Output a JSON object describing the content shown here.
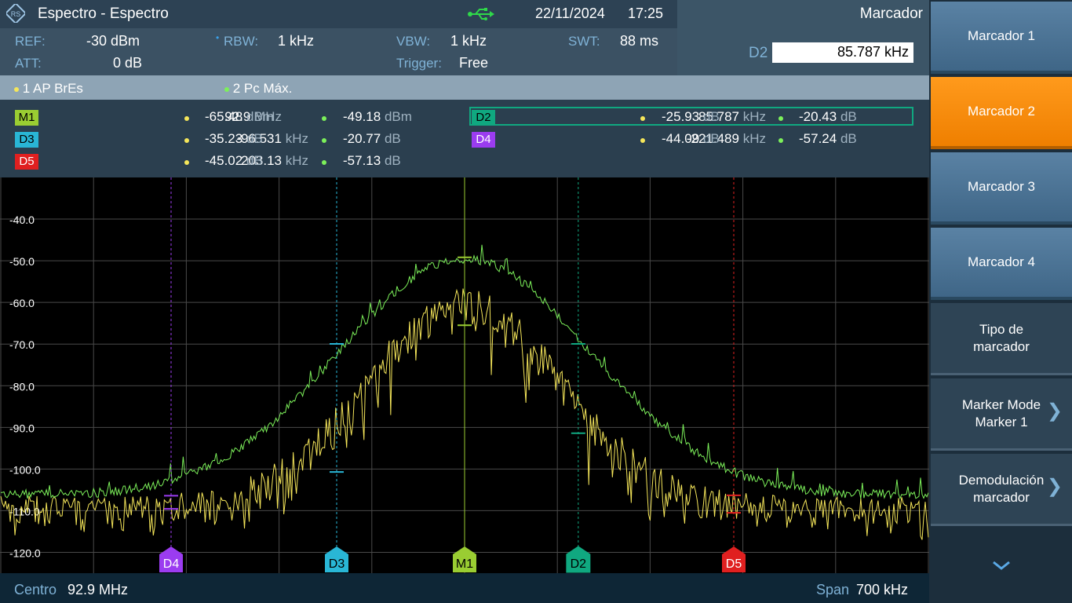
{
  "header": {
    "title": "Espectro - Espectro",
    "date": "22/11/2024",
    "time": "17:25",
    "menu_title": "Marcador"
  },
  "settings": {
    "ref_label": "REF:",
    "ref_value": "-30 dBm",
    "att_label": "ATT:",
    "att_value": "0 dB",
    "rbw_label": "RBW:",
    "rbw_value": "1 kHz",
    "vbw_label": "VBW:",
    "vbw_value": "1 kHz",
    "trigger_label": "Trigger:",
    "trigger_value": "Free",
    "swt_label": "SWT:",
    "swt_value": "88 ms",
    "d2_input_label": "D2",
    "d2_input_value": "85.787 kHz"
  },
  "traces": [
    {
      "label": "1 AP  BrEs",
      "color": "#f5e65a"
    },
    {
      "label": "2 Pc  Máx.",
      "color": "#7cf05a"
    }
  ],
  "marker_table": [
    {
      "id": "M1",
      "badge_bg": "#9acd32",
      "badge_fg": "#000",
      "x_val": "92.9",
      "x_unit": "MHz",
      "t1_val": "-65.48",
      "t1_unit": "dBm",
      "t2_val": "-49.18",
      "t2_unit": "dBm"
    },
    {
      "id": "D3",
      "badge_bg": "#29b6d6",
      "badge_fg": "#000",
      "x_val": "-96.531",
      "x_unit": "kHz",
      "t1_val": "-35.23",
      "t1_unit": "dB",
      "t2_val": "-20.77",
      "t2_unit": "dB"
    },
    {
      "id": "D5",
      "badge_bg": "#e02020",
      "badge_fg": "#fff",
      "x_val": "203.13",
      "x_unit": "kHz",
      "t1_val": "-45.02",
      "t1_unit": "dB",
      "t2_val": "-57.13",
      "t2_unit": "dB"
    },
    {
      "id": "D2",
      "badge_bg": "#10a880",
      "badge_fg": "#000",
      "x_val": "85.787",
      "x_unit": "kHz",
      "t1_val": "-25.93",
      "t1_unit": "dB",
      "t2_val": "-20.43",
      "t2_unit": "dB"
    },
    {
      "id": "D4",
      "badge_bg": "#9b3cf0",
      "badge_fg": "#fff",
      "x_val": "-221.489",
      "x_unit": "kHz",
      "t1_val": "-44.09",
      "t1_unit": "dB",
      "t2_val": "-57.24",
      "t2_unit": "dB"
    }
  ],
  "chart_data": {
    "type": "line",
    "ylim": [
      -125,
      -30
    ],
    "xlim_khz": [
      -350,
      350
    ],
    "y_ticks": [
      "-40.0",
      "-50.0",
      "-60.0",
      "-70.0",
      "-80.0",
      "-90.0",
      "-100.0",
      "-110.0",
      "-120.0"
    ],
    "grid": true,
    "series": [
      {
        "color": "#f5e65a"
      },
      {
        "color": "#7cf05a"
      }
    ],
    "markers": [
      {
        "id": "D4",
        "x_khz": -221.489,
        "color": "#9b3cf0"
      },
      {
        "id": "D3",
        "x_khz": -96.531,
        "color": "#29b6d6"
      },
      {
        "id": "M1",
        "x_khz": 0,
        "color": "#9acd32"
      },
      {
        "id": "D2",
        "x_khz": 85.787,
        "color": "#10a880"
      },
      {
        "id": "D5",
        "x_khz": 203.13,
        "color": "#e02020"
      }
    ]
  },
  "footer": {
    "center_label": "Centro",
    "center_value": "92.9 MHz",
    "span_label": "Span",
    "span_value": "700 kHz"
  },
  "softkeys": [
    {
      "label": "Marcador 1"
    },
    {
      "label": "Marcador 2"
    },
    {
      "label": "Marcador 3"
    },
    {
      "label": "Marcador 4"
    },
    {
      "label": "Tipo de\nmarcador"
    },
    {
      "label": "Marker Mode\nMarker 1"
    },
    {
      "label": "Demodulación\nmarcador"
    }
  ]
}
